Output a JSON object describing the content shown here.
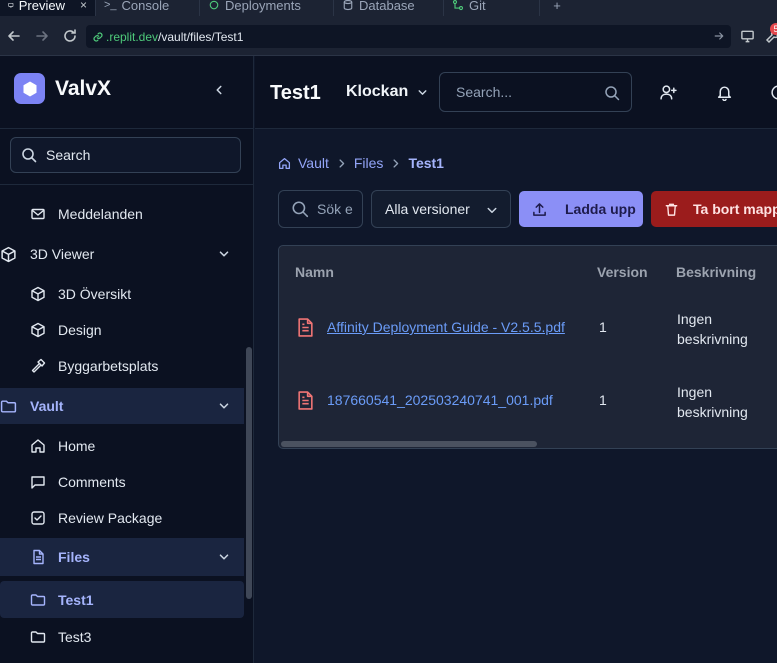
{
  "browser": {
    "tabs": [
      {
        "label": "Preview",
        "icon": "preview-icon",
        "active": true
      },
      {
        "label": "Console",
        "icon": "terminal-icon"
      },
      {
        "label": "Deployments",
        "icon": "deployments-icon"
      },
      {
        "label": "Database",
        "icon": "database-icon"
      },
      {
        "label": "Git",
        "icon": "git-icon"
      }
    ],
    "close_glyph": "×",
    "new_tab_glyph": "+",
    "url_domain": ".replit.dev",
    "url_path": "/vault/files/Test1",
    "notification_badge": "5"
  },
  "sidebar": {
    "brand": "ValvX",
    "search_label": "Search",
    "items": [
      {
        "label": "Meddelanden",
        "icon": "mail-icon"
      },
      {
        "label": "3D Viewer",
        "icon": "cube-icon"
      },
      {
        "label": "3D Översikt",
        "icon": "cube-icon"
      },
      {
        "label": "Design",
        "icon": "cube-icon"
      },
      {
        "label": "Byggarbetsplats",
        "icon": "hammer-icon"
      },
      {
        "label": "Vault",
        "icon": "folder-icon"
      },
      {
        "label": "Home",
        "icon": "home-icon"
      },
      {
        "label": "Comments",
        "icon": "comment-icon"
      },
      {
        "label": "Review Package",
        "icon": "checkbox-icon"
      },
      {
        "label": "Files",
        "icon": "file-icon"
      },
      {
        "label": "Test1",
        "icon": "folder-icon"
      },
      {
        "label": "Test3",
        "icon": "folder-icon"
      }
    ]
  },
  "header": {
    "title": "Test1",
    "org": "Klockan",
    "search_placeholder": "Search..."
  },
  "breadcrumb": [
    "Vault",
    "Files",
    "Test1"
  ],
  "toolbar": {
    "filter_placeholder": "Sök e",
    "version_select": "Alla versioner",
    "upload_label": "Ladda upp",
    "delete_label": "Ta bort mapp"
  },
  "table": {
    "columns": [
      "Namn",
      "Version",
      "Beskrivning"
    ],
    "rows": [
      {
        "name": "Affinity Deployment Guide - V2.5.5.pdf",
        "version": "1",
        "description": "Ingen beskrivning"
      },
      {
        "name": "187660541_202503240741_001.pdf",
        "version": "1",
        "description": "Ingen beskrivning"
      }
    ]
  },
  "colors": {
    "accent": "#8b8ff6",
    "danger": "#9b1c1c",
    "link": "#6b9cf8",
    "file_icon": "#f07575",
    "domain": "#4ec97a"
  }
}
